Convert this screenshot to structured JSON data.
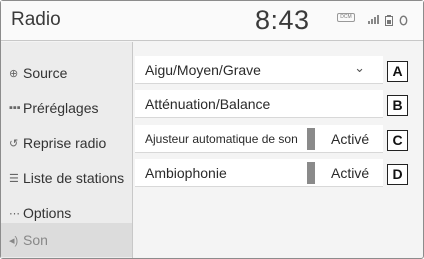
{
  "header": {
    "title": "Radio",
    "clock": "8:43",
    "status_label": "DCM"
  },
  "sidebar": {
    "items": [
      {
        "label": "Source",
        "icon": "source-icon",
        "glyph": "⊕"
      },
      {
        "label": "Préréglages",
        "icon": "presets-icon",
        "glyph": "▪▪▪"
      },
      {
        "label": "Reprise radio",
        "icon": "replay-icon",
        "glyph": "↺"
      },
      {
        "label": "Liste de stations",
        "icon": "station-list-icon",
        "glyph": "☰"
      },
      {
        "label": "Options",
        "icon": "more-icon",
        "glyph": "⋯"
      },
      {
        "label": "Son",
        "icon": "speaker-icon",
        "glyph": "◂)",
        "active": true
      }
    ]
  },
  "settings": {
    "rows": [
      {
        "label": "Aigu/Moyen/Grave",
        "chevron": "⌄",
        "callout": "A"
      },
      {
        "label": "Atténuation/Balance",
        "callout": "B"
      },
      {
        "label": "Ajusteur automatique de son",
        "toggle": "Activé",
        "callout": "C"
      },
      {
        "label": "Ambiophonie",
        "toggle": "Activé",
        "callout": "D"
      }
    ]
  },
  "colors": {
    "background": "#f4f4f4",
    "sidebar": "#ececec",
    "active_item": "#dcdcdc",
    "row": "#ffffff",
    "toggle_bar": "#8a8a8a"
  }
}
